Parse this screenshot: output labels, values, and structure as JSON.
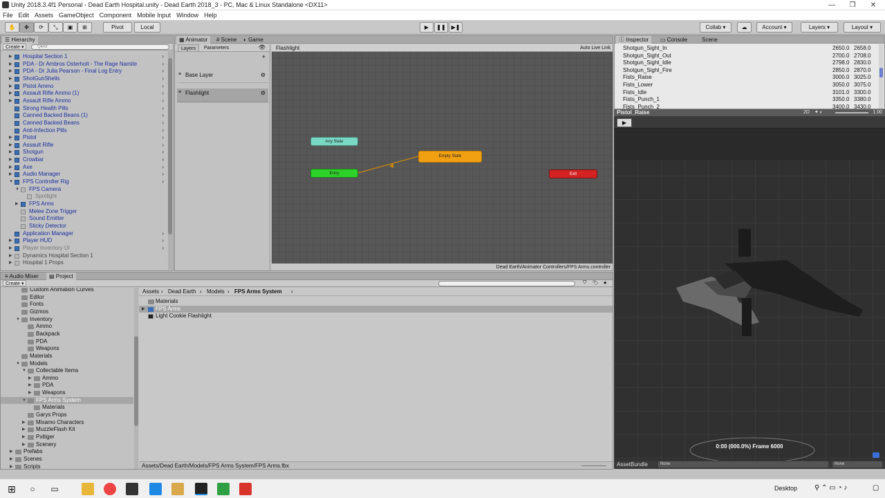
{
  "window": {
    "title": "Unity 2018.3.4f1 Personal - Dead Earth Hospital.unity - Dead Earth 2018_3 - PC, Mac & Linux Standalone <DX11>",
    "minimize": "—",
    "maximize": "❐",
    "close": "✕"
  },
  "menu": [
    "File",
    "Edit",
    "Assets",
    "GameObject",
    "Component",
    "Mobile Input",
    "Window",
    "Help"
  ],
  "toolbar": {
    "pivot": "Pivot",
    "local": "Local",
    "collab": "Collab ▾",
    "account": "Account",
    "layers": "Layers",
    "layout": "Layout"
  },
  "hierarchy": {
    "tab": "Hierarchy",
    "create": "Create",
    "search_placeholder": "Q▾All",
    "items": [
      {
        "label": "Hospital Section 1",
        "depth": 0,
        "arrow": "▶",
        "icon": "cube",
        "color": "blue",
        "chevron": true
      },
      {
        "label": "PDA - Dr Ambros Osterholt - The Rage Namite",
        "depth": 0,
        "arrow": "▶",
        "icon": "cube",
        "color": "blue",
        "chevron": true
      },
      {
        "label": "PDA - Dr Julia Pearson - Final Log Entry",
        "depth": 0,
        "arrow": "▶",
        "icon": "cube",
        "color": "blue",
        "chevron": true
      },
      {
        "label": "ShotGunShells",
        "depth": 0,
        "arrow": "▶",
        "icon": "cube",
        "color": "blue",
        "chevron": true
      },
      {
        "label": "Pistol Ammo",
        "depth": 0,
        "arrow": "▶",
        "icon": "cube",
        "color": "blue",
        "chevron": true
      },
      {
        "label": "Assault Rifle Ammo (1)",
        "depth": 0,
        "arrow": "▶",
        "icon": "cube",
        "color": "blue",
        "chevron": true
      },
      {
        "label": "Assault Rifle Ammo",
        "depth": 0,
        "arrow": "▶",
        "icon": "cube",
        "color": "blue",
        "chevron": true
      },
      {
        "label": "Strong Health Pills",
        "depth": 0,
        "arrow": "",
        "icon": "cube",
        "color": "blue",
        "chevron": true
      },
      {
        "label": "Canned Backed Beans (1)",
        "depth": 0,
        "arrow": "",
        "icon": "cube",
        "color": "blue",
        "chevron": true
      },
      {
        "label": "Canned Backed Beans",
        "depth": 0,
        "arrow": "",
        "icon": "cube",
        "color": "blue",
        "chevron": true
      },
      {
        "label": "Anti-Infection Pills",
        "depth": 0,
        "arrow": "",
        "icon": "cube",
        "color": "blue",
        "chevron": true
      },
      {
        "label": "Pistol",
        "depth": 0,
        "arrow": "▶",
        "icon": "cube",
        "color": "blue",
        "chevron": true
      },
      {
        "label": "Assault Rifle",
        "depth": 0,
        "arrow": "▶",
        "icon": "cube",
        "color": "blue",
        "chevron": true
      },
      {
        "label": "Shotgun",
        "depth": 0,
        "arrow": "▶",
        "icon": "cube",
        "color": "blue",
        "chevron": true
      },
      {
        "label": "Crowbar",
        "depth": 0,
        "arrow": "▶",
        "icon": "cube",
        "color": "blue",
        "chevron": true
      },
      {
        "label": "Axe",
        "depth": 0,
        "arrow": "▶",
        "icon": "cube",
        "color": "blue",
        "chevron": true
      },
      {
        "label": "Audio Manager",
        "depth": 0,
        "arrow": "▶",
        "icon": "cube",
        "color": "blue",
        "chevron": true
      },
      {
        "label": "FPS Controller Rig",
        "depth": 0,
        "arrow": "▼",
        "icon": "cube",
        "color": "blue",
        "chevron": true
      },
      {
        "label": "FPS Camera",
        "depth": 1,
        "arrow": "▼",
        "icon": "cube-g",
        "color": "blue",
        "chevron": false
      },
      {
        "label": "Spotlight",
        "depth": 2,
        "arrow": "",
        "icon": "cube-g",
        "color": "grey",
        "chevron": false
      },
      {
        "label": "FPS Arms",
        "depth": 1,
        "arrow": "▶",
        "icon": "cube",
        "color": "blue",
        "chevron": false
      },
      {
        "label": "Melee Zone Trigger",
        "depth": 1,
        "arrow": "",
        "icon": "cube-g",
        "color": "blue",
        "chevron": false
      },
      {
        "label": "Sound Emitter",
        "depth": 1,
        "arrow": "",
        "icon": "cube-g",
        "color": "blue",
        "chevron": false
      },
      {
        "label": "Sticky Detector",
        "depth": 1,
        "arrow": "",
        "icon": "cube-g",
        "color": "blue",
        "chevron": false
      },
      {
        "label": "Application Manager",
        "depth": 0,
        "arrow": "",
        "icon": "cube",
        "color": "blue",
        "chevron": true
      },
      {
        "label": "Player HUD",
        "depth": 0,
        "arrow": "▶",
        "icon": "cube",
        "color": "blue",
        "chevron": true
      },
      {
        "label": "Player Inventory UI",
        "depth": 0,
        "arrow": "▶",
        "icon": "cube",
        "color": "grey",
        "chevron": true
      },
      {
        "label": "Dynamics Hospital Section 1",
        "depth": 0,
        "arrow": "▶",
        "icon": "cube-g",
        "color": "dkgrey",
        "chevron": false
      },
      {
        "label": "Hospital 1 Props",
        "depth": 0,
        "arrow": "▶",
        "icon": "cube-g",
        "color": "dkgrey",
        "chevron": false
      }
    ]
  },
  "animator": {
    "tabs": [
      "Animator",
      "Scene",
      "Game"
    ],
    "subtabs": [
      "Layers",
      "Parameters"
    ],
    "layers": [
      "Base Layer",
      "Flashlight"
    ],
    "breadcrumb": "Flashlight",
    "auto_live_link": "Auto Live Link",
    "path": "Dead Earth/Animator Controllers/FPS Arms.controller",
    "states": {
      "any": "Any State",
      "entry": "Entry",
      "empty": "Empty State",
      "exit": "Exit"
    },
    "colors": {
      "any": "#79d8c4",
      "entry": "#2ed12a",
      "empty": "#f1a012",
      "exit": "#d42222"
    }
  },
  "inspector": {
    "tabs": [
      "Inspector",
      "Console",
      "Scene"
    ],
    "clips": [
      {
        "name": "Shotgun_Sight_In",
        "start": "2650.0",
        "end": "2658.0"
      },
      {
        "name": "Shotgun_Sight_Out",
        "start": "2700.0",
        "end": "2708.0"
      },
      {
        "name": "Shotgun_Sight_Idle",
        "start": "2798.0",
        "end": "2830.0"
      },
      {
        "name": "Shotgun_Sight_Fire",
        "start": "2850.0",
        "end": "2870.0"
      },
      {
        "name": "Fists_Raise",
        "start": "3000.0",
        "end": "3025.0"
      },
      {
        "name": "Fists_Lower",
        "start": "3050.0",
        "end": "3075.0"
      },
      {
        "name": "Fists_Idle",
        "start": "3101.0",
        "end": "3300.0"
      },
      {
        "name": "Fists_Punch_1",
        "start": "3350.0",
        "end": "3380.0"
      },
      {
        "name": "Fists_Punch_2",
        "start": "3400.0",
        "end": "3430.0"
      }
    ],
    "preview_title": "Pistol_Raise",
    "preview_2d": "2D",
    "preview_speed": "1.00",
    "preview_time": "0:00 (000.0%) Frame 6000",
    "assetbundle_label": "AssetBundle",
    "assetbundle_value": "None",
    "assetbundle_variant": "None"
  },
  "bottom": {
    "tabs": [
      "Audio Mixer",
      "Project"
    ],
    "create": "Create",
    "breadcrumb": [
      "Assets",
      "Dead Earth",
      "Models",
      "FPS Arms System"
    ],
    "files": [
      "Materials",
      "FPS Arms",
      "Light Cookie Flashlight"
    ],
    "status_path": "Assets/Dead Earth/Models/FPS Arms System/FPS Arms.fbx",
    "tree": [
      {
        "label": "Custom Animation Curves",
        "depth": 2,
        "arrow": ""
      },
      {
        "label": "Editor",
        "depth": 2,
        "arrow": ""
      },
      {
        "label": "Fonts",
        "depth": 2,
        "arrow": ""
      },
      {
        "label": "Gizmos",
        "depth": 2,
        "arrow": ""
      },
      {
        "label": "Inventory",
        "depth": 2,
        "arrow": "▼"
      },
      {
        "label": "Ammo",
        "depth": 3,
        "arrow": ""
      },
      {
        "label": "Backpack",
        "depth": 3,
        "arrow": ""
      },
      {
        "label": "PDA",
        "depth": 3,
        "arrow": ""
      },
      {
        "label": "Weapons",
        "depth": 3,
        "arrow": ""
      },
      {
        "label": "Materials",
        "depth": 2,
        "arrow": ""
      },
      {
        "label": "Models",
        "depth": 2,
        "arrow": "▼"
      },
      {
        "label": "Collectable Items",
        "depth": 3,
        "arrow": "▼"
      },
      {
        "label": "Ammo",
        "depth": 4,
        "arrow": "▶"
      },
      {
        "label": "PDA",
        "depth": 4,
        "arrow": "▶"
      },
      {
        "label": "Weapons",
        "depth": 4,
        "arrow": "▶"
      },
      {
        "label": "FPS Arms System",
        "depth": 3,
        "arrow": "▼"
      },
      {
        "label": "Materials",
        "depth": 4,
        "arrow": ""
      },
      {
        "label": "Garys Props",
        "depth": 3,
        "arrow": ""
      },
      {
        "label": "Mixamo Characters",
        "depth": 3,
        "arrow": "▶"
      },
      {
        "label": "MuzzleFlash Kit",
        "depth": 3,
        "arrow": "▶"
      },
      {
        "label": "Pxltiger",
        "depth": 3,
        "arrow": "▶"
      },
      {
        "label": "Scenery",
        "depth": 3,
        "arrow": "▶"
      },
      {
        "label": "Prefabs",
        "depth": 1,
        "arrow": "▶"
      },
      {
        "label": "Scenes",
        "depth": 1,
        "arrow": "▶"
      },
      {
        "label": "Scripts",
        "depth": 1,
        "arrow": "▶"
      }
    ]
  },
  "taskbar": {
    "desktop": "Desktop"
  }
}
